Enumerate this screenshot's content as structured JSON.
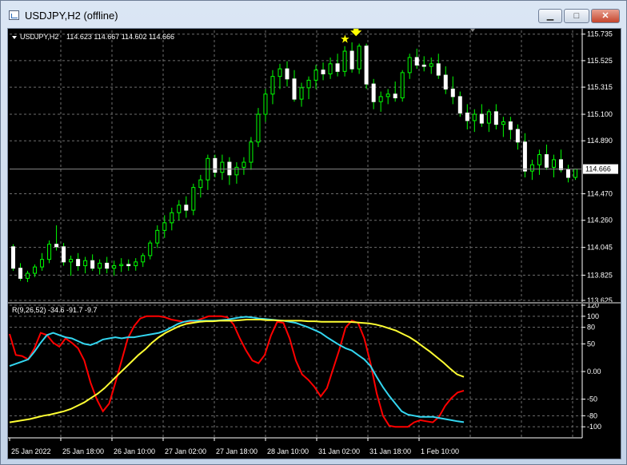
{
  "window": {
    "title": "USDJPY,H2 (offline)",
    "buttons": {
      "minimize": "▁",
      "maximize": "□",
      "close": "✕"
    }
  },
  "colors": {
    "background": "#000000",
    "grid": "#6e6e6e",
    "bull": "#00ff00",
    "bear": "#ffffff",
    "sep": "#777777",
    "current_price_line": "#888888",
    "arrow": "#ffff00",
    "line_red": "#ff0000",
    "line_aqua": "#33d6f0",
    "line_yellow": "#ffff33",
    "axis_text": "#ffffff"
  },
  "icons": {
    "arrow_down": "down-arrow-icon",
    "star": "star-icon",
    "dropdown": "triangle-down-icon"
  },
  "chart_data": [
    {
      "type": "candlestick",
      "symbol_label": "USDJPY,H2",
      "ohlc_header": "114.623 114.667 114.602 114.666",
      "current_price": "114.666",
      "ylim": [
        113.625,
        115.765
      ],
      "y_ticks": [
        "115.735",
        "115.525",
        "115.315",
        "115.100",
        "114.890",
        "114.470",
        "114.260",
        "114.045",
        "113.825",
        "113.625"
      ],
      "x_ticks": [
        "25 Jan 2022",
        "25 Jan 18:00",
        "26 Jan 10:00",
        "27 Jan 02:00",
        "27 Jan 18:00",
        "28 Jan 10:00",
        "31 Jan 02:00",
        "31 Jan 18:00",
        "1 Feb 10:00"
      ],
      "candles": [
        [
          114.05,
          114.07,
          113.86,
          113.88
        ],
        [
          113.88,
          113.92,
          113.78,
          113.8
        ],
        [
          113.8,
          113.86,
          113.77,
          113.84
        ],
        [
          113.84,
          113.91,
          113.81,
          113.89
        ],
        [
          113.89,
          114.0,
          113.86,
          113.95
        ],
        [
          113.95,
          114.1,
          113.92,
          114.07
        ],
        [
          114.07,
          114.22,
          114.02,
          114.05
        ],
        [
          114.05,
          114.08,
          113.9,
          113.93
        ],
        [
          113.93,
          113.98,
          113.82,
          113.95
        ],
        [
          113.95,
          114.0,
          113.86,
          113.9
        ],
        [
          113.9,
          113.97,
          113.84,
          113.94
        ],
        [
          113.94,
          113.99,
          113.86,
          113.88
        ],
        [
          113.88,
          113.95,
          113.83,
          113.92
        ],
        [
          113.92,
          113.97,
          113.84,
          113.88
        ],
        [
          113.88,
          113.94,
          113.82,
          113.9
        ],
        [
          113.9,
          113.96,
          113.85,
          113.91
        ],
        [
          113.91,
          113.95,
          113.86,
          113.9
        ],
        [
          113.9,
          113.96,
          113.86,
          113.93
        ],
        [
          113.93,
          114.0,
          113.89,
          113.98
        ],
        [
          113.98,
          114.1,
          113.95,
          114.08
        ],
        [
          114.08,
          114.22,
          114.04,
          114.18
        ],
        [
          114.18,
          114.3,
          114.12,
          114.24
        ],
        [
          114.24,
          114.36,
          114.18,
          114.32
        ],
        [
          114.32,
          114.42,
          114.26,
          114.38
        ],
        [
          114.38,
          114.45,
          114.28,
          114.34
        ],
        [
          114.34,
          114.55,
          114.3,
          114.52
        ],
        [
          114.52,
          114.62,
          114.44,
          114.58
        ],
        [
          114.58,
          114.78,
          114.5,
          114.75
        ],
        [
          114.75,
          114.78,
          114.6,
          114.64
        ],
        [
          114.64,
          114.78,
          114.58,
          114.72
        ],
        [
          114.72,
          114.76,
          114.54,
          114.62
        ],
        [
          114.62,
          114.72,
          114.55,
          114.68
        ],
        [
          114.68,
          114.76,
          114.62,
          114.72
        ],
        [
          114.72,
          114.92,
          114.66,
          114.88
        ],
        [
          114.88,
          115.15,
          114.84,
          115.1
        ],
        [
          115.1,
          115.3,
          115.04,
          115.26
        ],
        [
          115.26,
          115.45,
          115.18,
          115.4
        ],
        [
          115.4,
          115.5,
          115.3,
          115.46
        ],
        [
          115.46,
          115.52,
          115.32,
          115.38
        ],
        [
          115.38,
          115.45,
          115.2,
          115.22
        ],
        [
          115.22,
          115.35,
          115.16,
          115.31
        ],
        [
          115.31,
          115.4,
          115.22,
          115.37
        ],
        [
          115.37,
          115.49,
          115.3,
          115.45
        ],
        [
          115.45,
          115.51,
          115.37,
          115.42
        ],
        [
          115.42,
          115.55,
          115.38,
          115.5
        ],
        [
          115.5,
          115.58,
          115.4,
          115.44
        ],
        [
          115.44,
          115.64,
          115.4,
          115.6
        ],
        [
          115.6,
          115.67,
          115.43,
          115.46
        ],
        [
          115.46,
          115.66,
          115.42,
          115.64
        ],
        [
          115.64,
          115.66,
          115.3,
          115.34
        ],
        [
          115.34,
          115.38,
          115.14,
          115.2
        ],
        [
          115.2,
          115.28,
          115.12,
          115.24
        ],
        [
          115.24,
          115.3,
          115.18,
          115.26
        ],
        [
          115.26,
          115.36,
          115.2,
          115.23
        ],
        [
          115.23,
          115.45,
          115.2,
          115.43
        ],
        [
          115.43,
          115.58,
          115.38,
          115.55
        ],
        [
          115.55,
          115.62,
          115.46,
          115.49
        ],
        [
          115.49,
          115.56,
          115.44,
          115.48
        ],
        [
          115.48,
          115.55,
          115.42,
          115.5
        ],
        [
          115.5,
          115.58,
          115.38,
          115.41
        ],
        [
          115.41,
          115.48,
          115.26,
          115.3
        ],
        [
          115.3,
          115.4,
          115.18,
          115.24
        ],
        [
          115.24,
          115.28,
          115.08,
          115.11
        ],
        [
          115.11,
          115.18,
          114.98,
          115.05
        ],
        [
          115.05,
          115.14,
          114.96,
          115.1
        ],
        [
          115.1,
          115.18,
          115.0,
          115.03
        ],
        [
          115.03,
          115.14,
          114.96,
          115.12
        ],
        [
          115.12,
          115.18,
          114.98,
          115.02
        ],
        [
          115.02,
          115.08,
          114.92,
          115.04
        ],
        [
          115.04,
          115.08,
          114.9,
          114.98
        ],
        [
          114.98,
          115.02,
          114.82,
          114.88
        ],
        [
          114.88,
          114.95,
          114.6,
          114.65
        ],
        [
          114.65,
          114.74,
          114.58,
          114.7
        ],
        [
          114.7,
          114.82,
          114.62,
          114.78
        ],
        [
          114.78,
          114.86,
          114.66,
          114.68
        ],
        [
          114.68,
          114.78,
          114.6,
          114.74
        ],
        [
          114.74,
          114.82,
          114.64,
          114.66
        ],
        [
          114.66,
          114.7,
          114.56,
          114.6
        ],
        [
          114.6,
          114.67,
          114.58,
          114.666
        ]
      ],
      "signal_candle_index": 46
    },
    {
      "type": "line",
      "header": "R(9,26,52) -34.6 -91.7 -9.7",
      "ylim": [
        -120,
        120
      ],
      "y_ticks": [
        "120",
        "100",
        "80",
        "50",
        "0.00",
        "-50",
        "-80",
        "-100"
      ],
      "series": [
        {
          "values": [
            68,
            30,
            28,
            22,
            42,
            70,
            66,
            52,
            45,
            60,
            52,
            42,
            20,
            -20,
            -50,
            -72,
            -58,
            -20,
            20,
            60,
            82,
            96,
            100,
            100,
            100,
            98,
            94,
            92,
            90,
            90,
            92,
            96,
            100,
            100,
            100,
            98,
            85,
            60,
            38,
            20,
            15,
            30,
            65,
            90,
            88,
            60,
            20,
            -5,
            -15,
            -28,
            -45,
            -30,
            5,
            40,
            80,
            92,
            88,
            60,
            15,
            -40,
            -80,
            -98,
            -100,
            -100,
            -100,
            -92,
            -88,
            -90,
            -92,
            -82,
            -62,
            -48,
            -38,
            -34.6
          ]
        },
        {
          "values": [
            10,
            14,
            18,
            22,
            36,
            52,
            66,
            70,
            66,
            62,
            60,
            55,
            50,
            48,
            52,
            58,
            60,
            62,
            60,
            62,
            62,
            64,
            66,
            68,
            70,
            74,
            80,
            86,
            90,
            92,
            92,
            92,
            92,
            92,
            93,
            94,
            96,
            98,
            99,
            98,
            96,
            95,
            94,
            93,
            92,
            90,
            88,
            84,
            80,
            75,
            70,
            62,
            55,
            48,
            42,
            38,
            30,
            22,
            10,
            -10,
            -28,
            -44,
            -58,
            -72,
            -78,
            -80,
            -82,
            -82,
            -82,
            -84,
            -86,
            -88,
            -90,
            -91.7
          ]
        },
        {
          "values": [
            -92,
            -90,
            -88,
            -86,
            -83,
            -80,
            -78,
            -75,
            -72,
            -68,
            -62,
            -56,
            -48,
            -40,
            -30,
            -18,
            -6,
            6,
            18,
            30,
            40,
            52,
            62,
            70,
            76,
            82,
            86,
            88,
            90,
            91,
            91,
            92,
            92,
            92,
            93,
            94,
            94,
            94,
            93,
            93,
            92,
            92,
            92,
            92,
            91,
            91,
            90,
            90,
            90,
            90,
            90,
            89,
            88,
            87,
            85,
            82,
            78,
            74,
            68,
            62,
            54,
            45,
            36,
            26,
            16,
            5,
            -5,
            -9.7
          ]
        }
      ]
    }
  ]
}
